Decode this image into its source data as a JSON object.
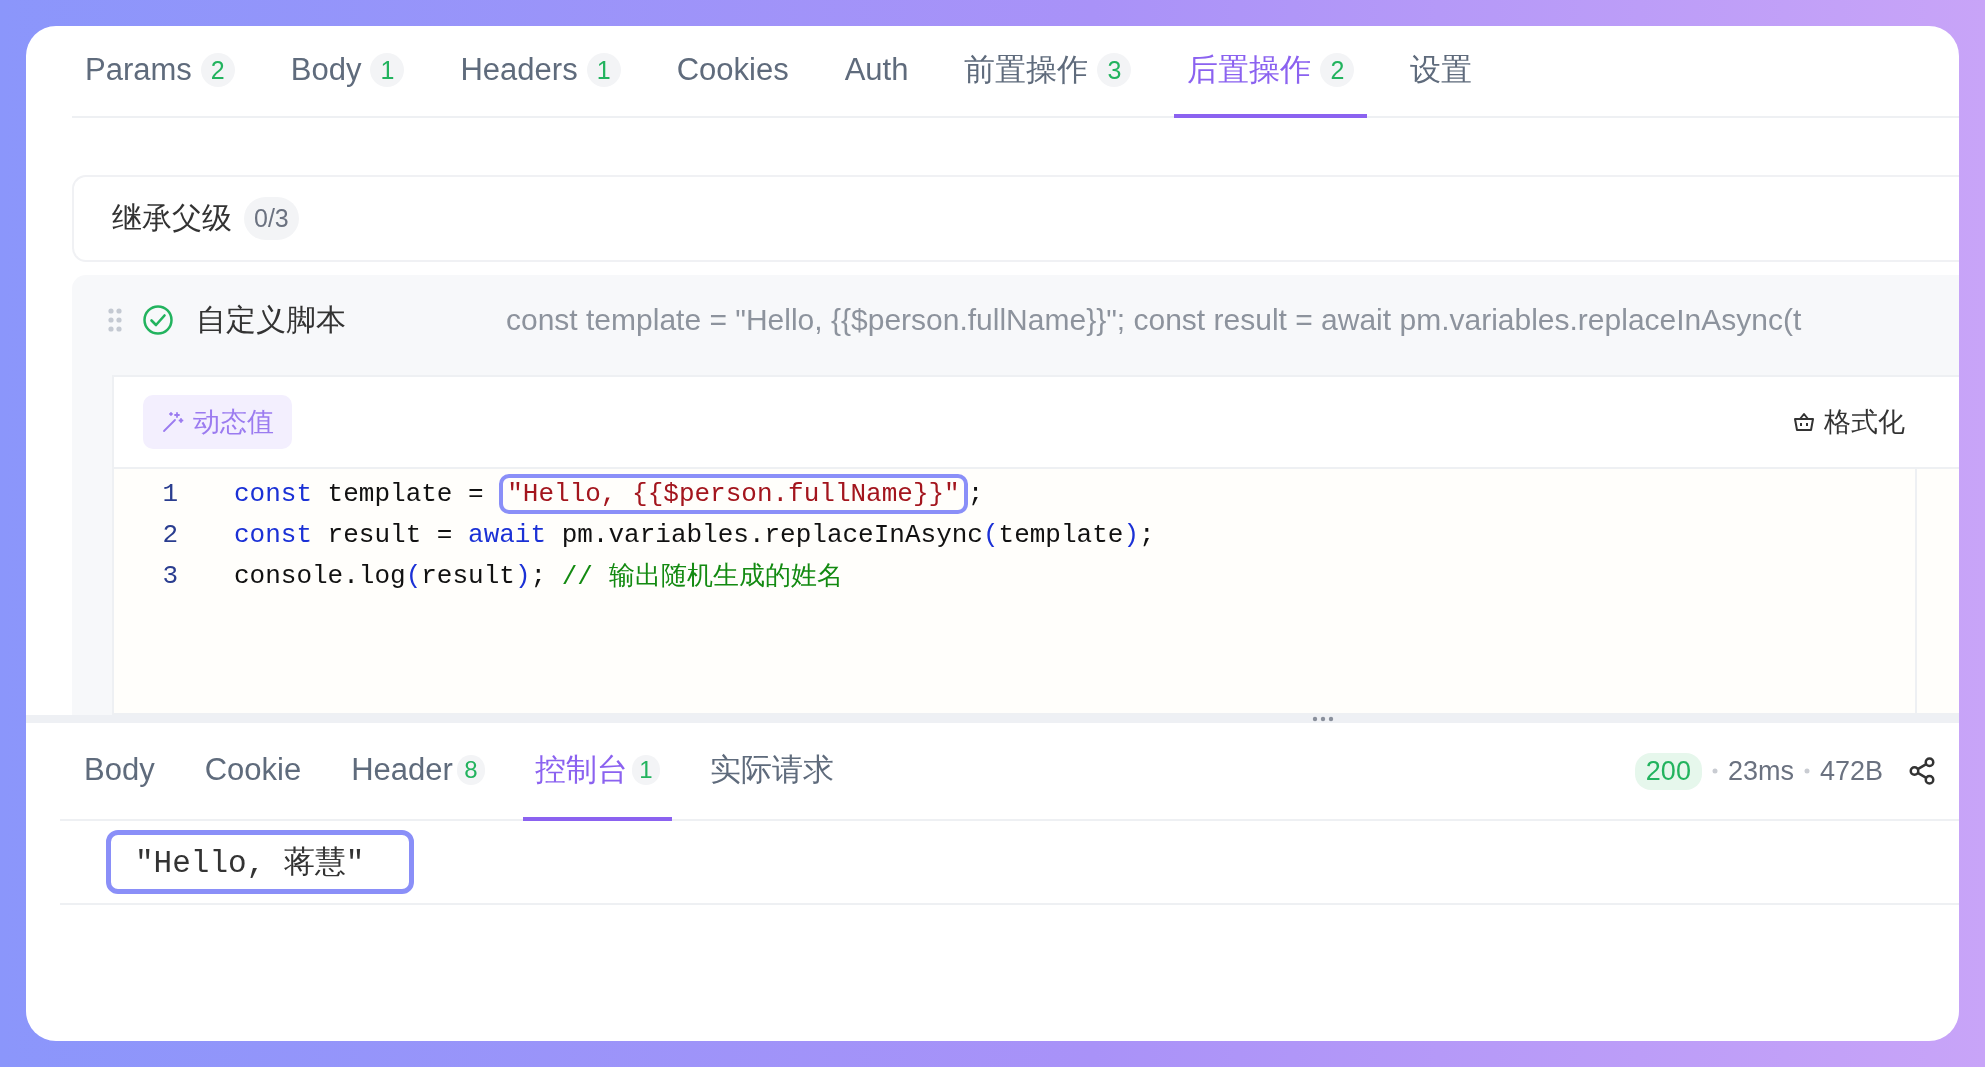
{
  "tabs": [
    {
      "label": "Params",
      "count": "2",
      "selected": false
    },
    {
      "label": "Body",
      "count": "1",
      "selected": false
    },
    {
      "label": "Headers",
      "count": "1",
      "selected": false
    },
    {
      "label": "Cookies",
      "selected": false
    },
    {
      "label": "Auth",
      "selected": false
    },
    {
      "label": "前置操作",
      "count": "3",
      "selected": false
    },
    {
      "label": "后置操作",
      "count": "2",
      "selected": true
    },
    {
      "label": "设置",
      "selected": false
    }
  ],
  "inherit": {
    "label": "继承父级",
    "count": "0/3"
  },
  "script": {
    "enabled": true,
    "title": "自定义脚本",
    "preview": "const template = \"Hello, {{$person.fullName}}\"; const result = await pm.variables.replaceInAsync(t"
  },
  "editor": {
    "dynamic_button": "动态值",
    "format_button": "格式化",
    "lines": [
      {
        "number": "1",
        "tokens": [
          {
            "kind": "keyword",
            "text": "const"
          },
          {
            "kind": "plain",
            "text": " template = "
          },
          {
            "kind": "string",
            "text": "\"Hello, {{$person.fullName}}\"",
            "highlighted": true
          },
          {
            "kind": "plain",
            "text": ";"
          }
        ]
      },
      {
        "number": "2",
        "tokens": [
          {
            "kind": "keyword",
            "text": "const"
          },
          {
            "kind": "plain",
            "text": " result = "
          },
          {
            "kind": "keyword",
            "text": "await"
          },
          {
            "kind": "plain",
            "text": " pm.variables.replaceInAsync"
          },
          {
            "kind": "paren",
            "text": "("
          },
          {
            "kind": "plain",
            "text": "template"
          },
          {
            "kind": "paren",
            "text": ")"
          },
          {
            "kind": "plain",
            "text": ";"
          }
        ]
      },
      {
        "number": "3",
        "tokens": [
          {
            "kind": "plain",
            "text": "console.log"
          },
          {
            "kind": "paren",
            "text": "("
          },
          {
            "kind": "plain",
            "text": "result"
          },
          {
            "kind": "paren",
            "text": ")"
          },
          {
            "kind": "plain",
            "text": "; "
          },
          {
            "kind": "comment",
            "text": "// 输出随机生成的姓名"
          }
        ]
      }
    ]
  },
  "response": {
    "tabs": [
      {
        "label": "Body",
        "selected": false
      },
      {
        "label": "Cookie",
        "selected": false
      },
      {
        "label": "Header",
        "count": "8",
        "selected": false
      },
      {
        "label": "控制台",
        "count": "1",
        "selected": true
      },
      {
        "label": "实际请求",
        "selected": false
      }
    ],
    "status": "200",
    "time": "23ms",
    "size": "472B",
    "console": [
      {
        "text": "\"Hello, 蒋慧\"",
        "highlighted": true
      }
    ]
  }
}
